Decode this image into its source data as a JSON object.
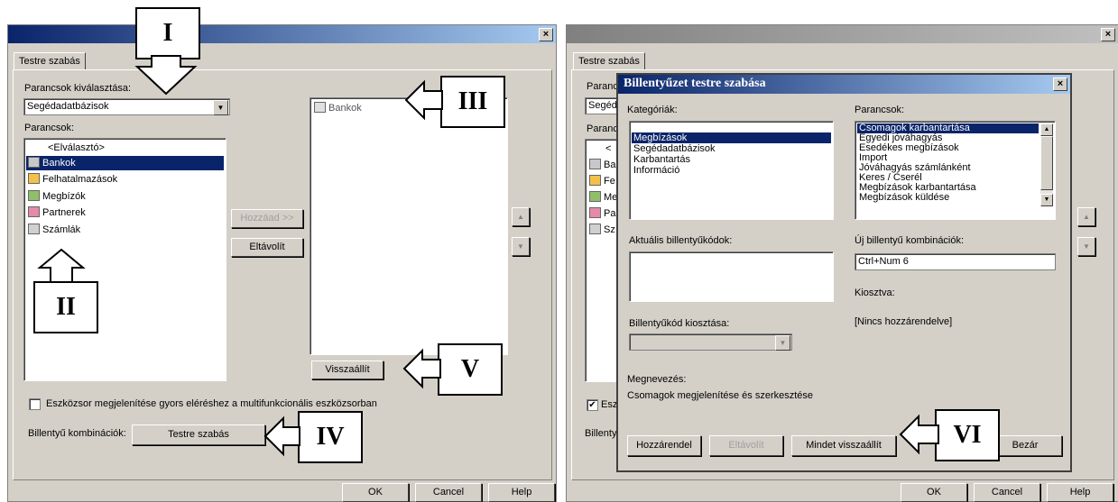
{
  "left": {
    "tab": "Testre szabás",
    "close": "×",
    "cmd_select_label": "Parancsok kiválasztása:",
    "cmd_select_value": "Segédadatbázisok",
    "commands_label": "Parancsok:",
    "commands": [
      "<Elválasztó>",
      "Bankok",
      "Felhatalmazások",
      "Megbízók",
      "Partnerek",
      "Számlák"
    ],
    "right_list": [
      "Bankok"
    ],
    "add_button": "Hozzáad >>",
    "remove_button": "Eltávolít",
    "reset_button": "Visszaállít",
    "checkbox_label": "Eszközsor megjelenítése gyors eléréshez a multifunkcionális eszközsorban",
    "shortcut_label": "Billentyű kombinációk:",
    "customize_button": "Testre szabás",
    "ok": "OK",
    "cancel": "Cancel",
    "help": "Help"
  },
  "right": {
    "tab": "Testre szabás",
    "close": "×",
    "bg_labels": [
      "Paranc",
      "Segéd",
      "Paranc",
      "<",
      "Ba",
      "Fe",
      "Me",
      "Pa",
      "Sz",
      "Esz",
      "Billenty"
    ],
    "ok": "OK",
    "cancel": "Cancel",
    "help": "Help"
  },
  "dialog": {
    "title": "Billentyűzet testre szabása",
    "close": "×",
    "categories_label": "Kategóriák:",
    "categories": [
      "Megbízások",
      "Segédadatbázisok",
      "Karbantartás",
      "Információ"
    ],
    "commands_label": "Parancsok:",
    "commands": [
      "Csomagok karbantartása",
      "Egyedi jóváhagyás",
      "Esedékes megbízások",
      "Import",
      "Jóváhagyás számlánként",
      "Keres / Cserél",
      "Megbízások karbantartása",
      "Megbízások küldése"
    ],
    "current_keys_label": "Aktuális billentyűkódok:",
    "new_combo_label": "Új billentyű kombinációk:",
    "new_combo_value": "Ctrl+Num 6",
    "assigned_label": "Kiosztva:",
    "assigned_value": "[Nincs hozzárendelve]",
    "key_assign_label": "Billentyűkód kiosztása:",
    "description_label": "Megnevezés:",
    "description_value": "Csomagok megjelenítése és szerkesztése",
    "assign_button": "Hozzárendel",
    "remove_button": "Eltávolít",
    "reset_all_button": "Mindet visszaállít",
    "close_button": "Bezár"
  },
  "callouts": [
    "I",
    "II",
    "III",
    "IV",
    "V",
    "VI"
  ]
}
